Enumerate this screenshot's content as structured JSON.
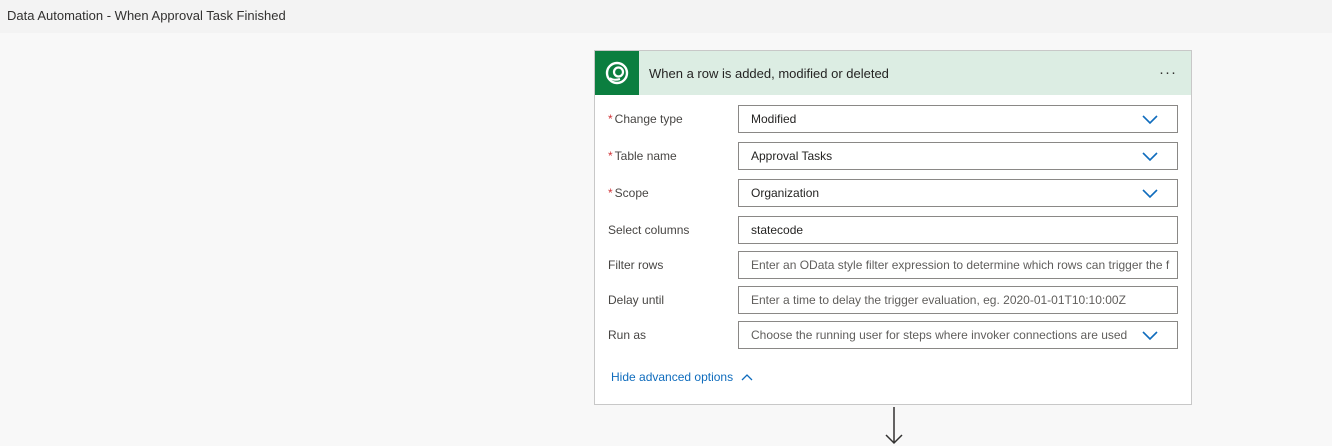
{
  "page": {
    "title": "Data Automation - When Approval Task Finished"
  },
  "trigger_card": {
    "title": "When a row is added, modified or deleted",
    "icon": "dataverse-icon",
    "more_label": "···",
    "fields": [
      {
        "label": "Change type",
        "required": true,
        "value": "Modified",
        "dropdown": true
      },
      {
        "label": "Table name",
        "required": true,
        "value": "Approval Tasks",
        "dropdown": true
      },
      {
        "label": "Scope",
        "required": true,
        "value": "Organization",
        "dropdown": true
      },
      {
        "label": "Select columns",
        "required": false,
        "value": "statecode",
        "dropdown": false
      },
      {
        "label": "Filter rows",
        "required": false,
        "placeholder": "Enter an OData style filter expression to determine which rows can trigger the f",
        "dropdown": false
      },
      {
        "label": "Delay until",
        "required": false,
        "placeholder": "Enter a time to delay the trigger evaluation, eg. 2020-01-01T10:10:00Z",
        "dropdown": false
      },
      {
        "label": "Run as",
        "required": false,
        "placeholder": "Choose the running user for steps where invoker connections are used",
        "dropdown": true
      }
    ],
    "advanced_link": "Hide advanced options",
    "required_marker": "*"
  },
  "colors": {
    "header_bg": "#dcede3",
    "icon_bg": "#0b7e3f",
    "link": "#0f6cbd",
    "required": "#d13438"
  }
}
